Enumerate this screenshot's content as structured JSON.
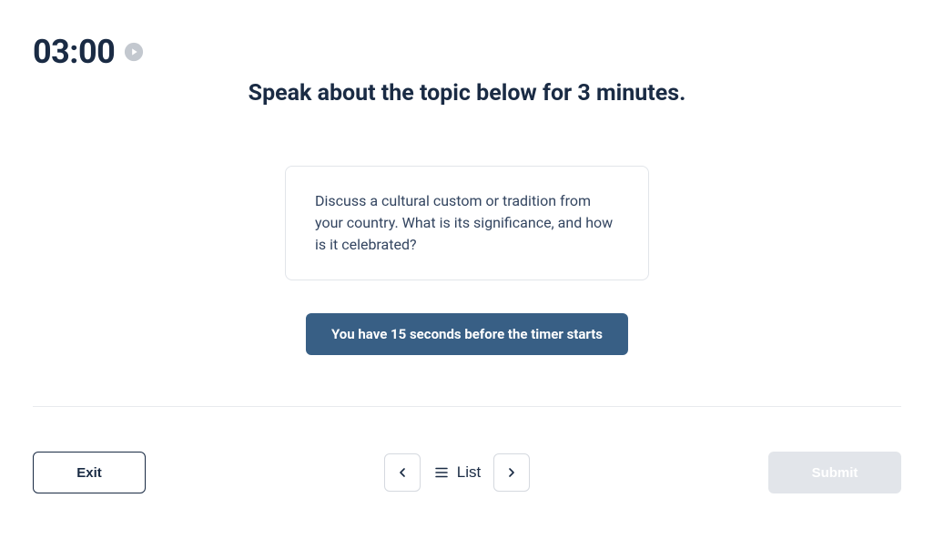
{
  "timer": {
    "value": "03:00"
  },
  "instruction": "Speak about the topic below for 3 minutes.",
  "topic": {
    "prompt": "Discuss a cultural custom or tradition from your country. What is its significance, and how is it celebrated?"
  },
  "countdown": {
    "message": "You have 15 seconds before the timer starts"
  },
  "footer": {
    "exit_label": "Exit",
    "list_label": "List",
    "submit_label": "Submit"
  }
}
